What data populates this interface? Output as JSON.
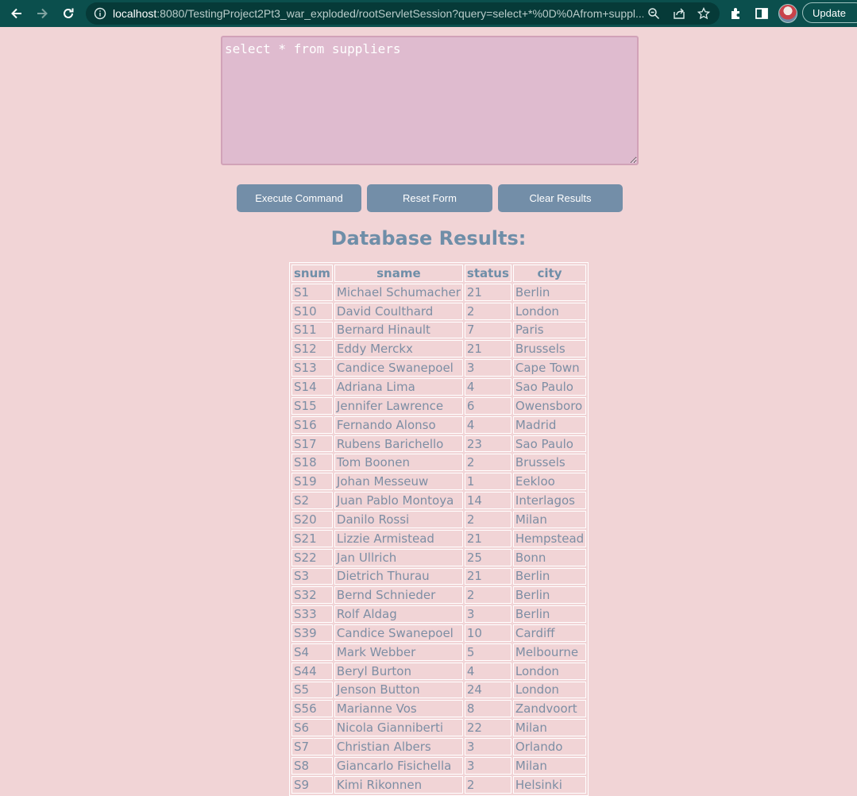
{
  "browser": {
    "url_host": "localhost",
    "url_rest": ":8080/TestingProject2Pt3_war_exploded/rootServletSession?query=select+*%0D%0Afrom+suppl...",
    "update_label": "Update"
  },
  "form": {
    "query_text": "select * from suppliers",
    "execute_label": "Execute Command",
    "reset_label": "Reset Form",
    "clear_label": "Clear Results"
  },
  "results": {
    "heading": "Database Results:",
    "columns": [
      "snum",
      "sname",
      "status",
      "city"
    ],
    "rows": [
      [
        "S1",
        "Michael Schumacher",
        "21",
        "Berlin"
      ],
      [
        "S10",
        "David Coulthard",
        "2",
        "London"
      ],
      [
        "S11",
        "Bernard Hinault",
        "7",
        "Paris"
      ],
      [
        "S12",
        "Eddy Merckx",
        "21",
        "Brussels"
      ],
      [
        "S13",
        "Candice Swanepoel",
        "3",
        "Cape Town"
      ],
      [
        "S14",
        "Adriana Lima",
        "4",
        "Sao Paulo"
      ],
      [
        "S15",
        "Jennifer Lawrence",
        "6",
        "Owensboro"
      ],
      [
        "S16",
        "Fernando Alonso",
        "4",
        "Madrid"
      ],
      [
        "S17",
        "Rubens Barichello",
        "23",
        "Sao Paulo"
      ],
      [
        "S18",
        "Tom Boonen",
        "2",
        "Brussels"
      ],
      [
        "S19",
        "Johan Messeuw",
        "1",
        "Eekloo"
      ],
      [
        "S2",
        "Juan Pablo Montoya",
        "14",
        "Interlagos"
      ],
      [
        "S20",
        "Danilo Rossi",
        "2",
        "Milan"
      ],
      [
        "S21",
        "Lizzie Armistead",
        "21",
        "Hempstead"
      ],
      [
        "S22",
        "Jan Ullrich",
        "25",
        "Bonn"
      ],
      [
        "S3",
        "Dietrich Thurau",
        "21",
        "Berlin"
      ],
      [
        "S32",
        "Bernd Schnieder",
        "2",
        "Berlin"
      ],
      [
        "S33",
        "Rolf Aldag",
        "3",
        "Berlin"
      ],
      [
        "S39",
        "Candice Swanepoel",
        "10",
        "Cardiff"
      ],
      [
        "S4",
        "Mark Webber",
        "5",
        "Melbourne"
      ],
      [
        "S44",
        "Beryl Burton",
        "4",
        "London"
      ],
      [
        "S5",
        "Jenson Button",
        "24",
        "London"
      ],
      [
        "S56",
        "Marianne Vos",
        "8",
        "Zandvoort"
      ],
      [
        "S6",
        "Nicola Gianniberti",
        "22",
        "Milan"
      ],
      [
        "S7",
        "Christian Albers",
        "3",
        "Orlando"
      ],
      [
        "S8",
        "Giancarlo Fisichella",
        "3",
        "Milan"
      ],
      [
        "S9",
        "Kimi Rikonnen",
        "2",
        "Helsinki"
      ]
    ]
  }
}
